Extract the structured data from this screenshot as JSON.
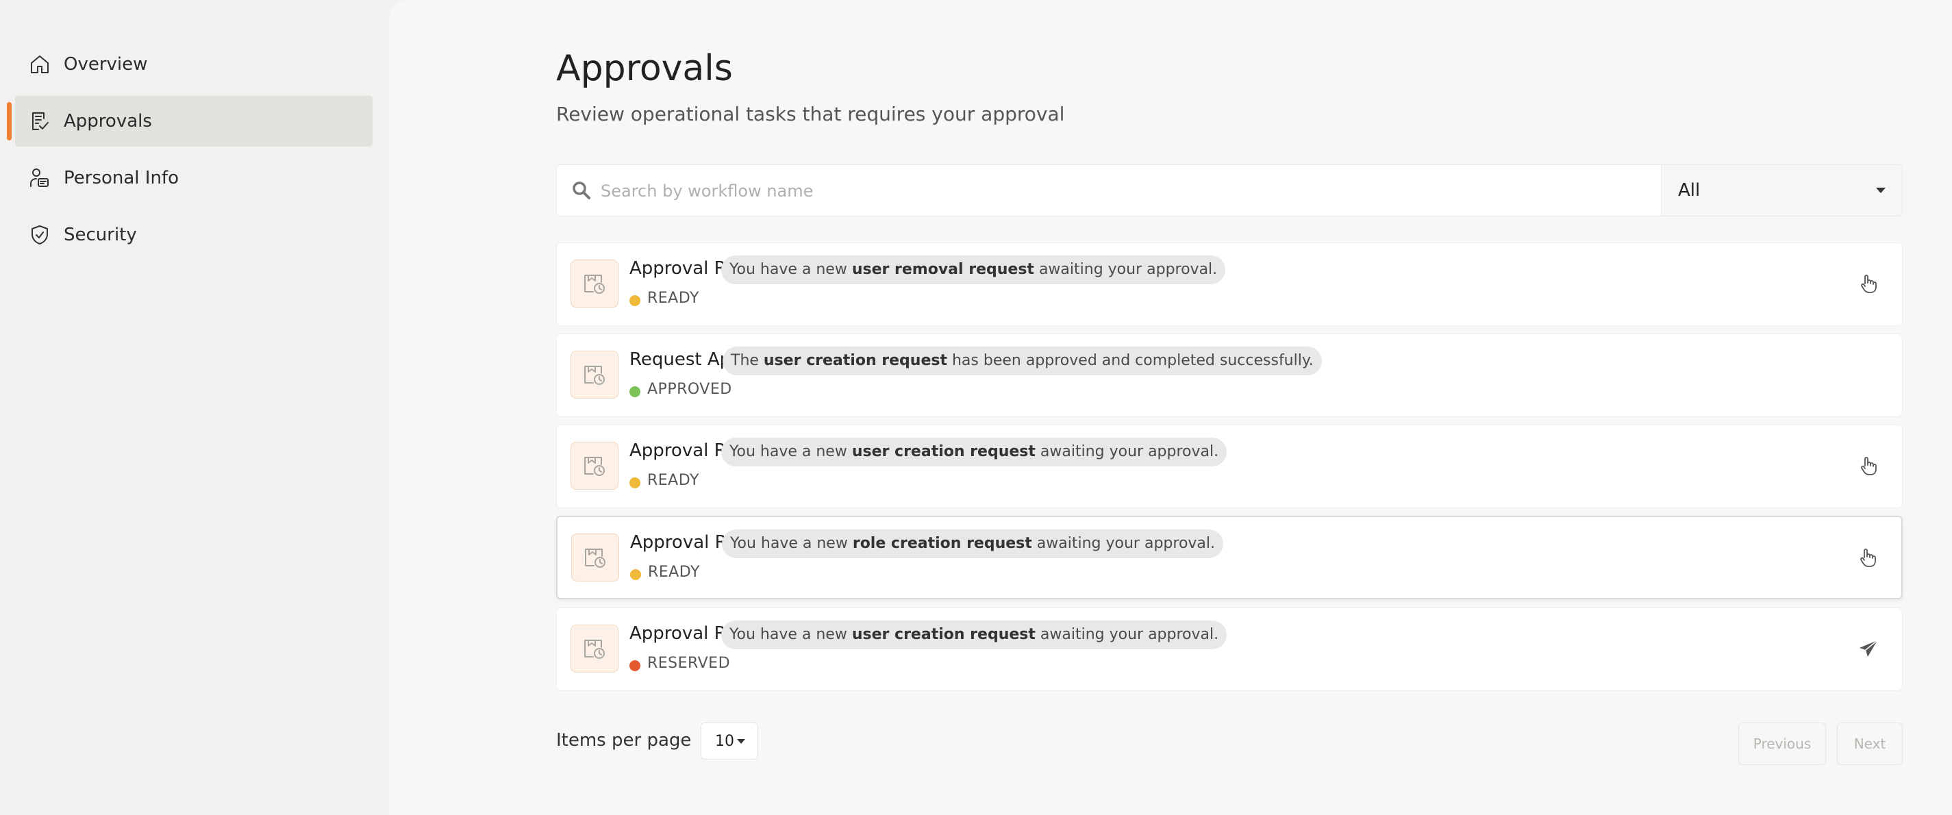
{
  "sidebar": {
    "items": [
      {
        "label": "Overview",
        "icon": "home-icon",
        "active": false
      },
      {
        "label": "Approvals",
        "icon": "approvals-icon",
        "active": true
      },
      {
        "label": "Personal Info",
        "icon": "person-badge-icon",
        "active": false
      },
      {
        "label": "Security",
        "icon": "shield-check-icon",
        "active": false
      }
    ]
  },
  "header": {
    "title": "Approvals",
    "subtitle": "Review operational tasks that requires your approval"
  },
  "search": {
    "placeholder": "Search by workflow name",
    "value": "",
    "filter_value": "All"
  },
  "tasks": [
    {
      "title": "Approval Required:",
      "msg_prefix": "You have a new",
      "msg_bold": "user removal request",
      "msg_suffix": "awaiting your approval.",
      "status": "READY",
      "status_color": "#f0b93a",
      "action_icon": "hand-pointer-icon"
    },
    {
      "title": "Request Approved:",
      "msg_prefix": "The",
      "msg_bold": "user creation request",
      "msg_suffix": "has been approved and completed successfully.",
      "status": "APPROVED",
      "status_color": "#7cc257",
      "action_icon": ""
    },
    {
      "title": "Approval Required:",
      "msg_prefix": "You have a new",
      "msg_bold": "user creation request",
      "msg_suffix": "awaiting your approval.",
      "status": "READY",
      "status_color": "#f0b93a",
      "action_icon": "hand-pointer-icon"
    },
    {
      "title": "Approval Required:",
      "msg_prefix": "You have a new",
      "msg_bold": "role creation request",
      "msg_suffix": "awaiting your approval.",
      "status": "READY",
      "status_color": "#f0b93a",
      "action_icon": "hand-pointer-icon"
    },
    {
      "title": "Approval Required:",
      "msg_prefix": "You have a new",
      "msg_bold": "user creation request",
      "msg_suffix": "awaiting your approval.",
      "status": "RESERVED",
      "status_color": "#e45a2e",
      "action_icon": "send-icon"
    }
  ],
  "pagination": {
    "items_per_page_label": "Items per page",
    "items_per_page_value": "10",
    "previous_label": "Previous",
    "next_label": "Next"
  },
  "colors": {
    "accent": "#ee7f33",
    "ready": "#f0b93a",
    "approved": "#7cc257",
    "reserved": "#e45a2e"
  }
}
